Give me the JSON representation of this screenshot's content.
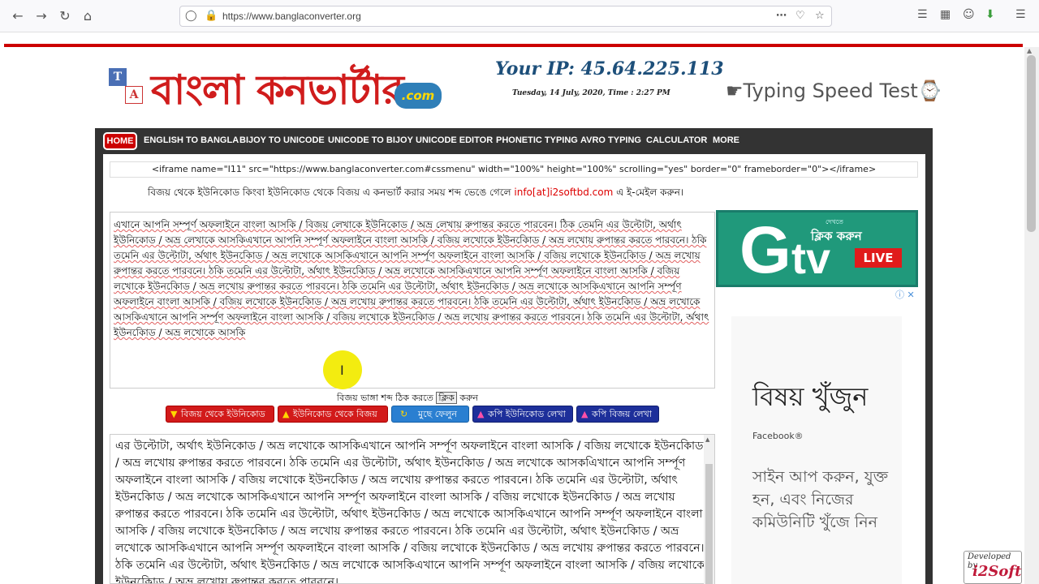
{
  "browser": {
    "url": "https://www.banglaconverter.org"
  },
  "header": {
    "brand": "বাংলা কনভার্টার",
    "brand_com": ".com",
    "ip": "Your IP: 45.64.225.113",
    "datetime": "Tuesday, 14 July, 2020, Time : 2:27 PM",
    "typing_speed": "☛Typing Speed Test⌚"
  },
  "nav": {
    "items": [
      "HOME",
      "ENGLISH TO BANGLA",
      "BIJOY TO UNICODE",
      "UNICODE TO BIJOY",
      "UNICODE EDITOR",
      "PHONETIC TYPING",
      "AVRO TYPING",
      "CALCULATOR",
      "MORE"
    ]
  },
  "embed_code": "<iframe name=\"I11\" src=\"https://www.banglaconverter.com#cssmenu\" width=\"100%\" height=\"100%\" scrolling=\"yes\" border=\"0\" frameborder=\"0\"></iframe>",
  "notice": {
    "text": "বিজয় থেকে ইউনিকোড কিংবা ইউনিকোড থেকে বিজয় এ কনভার্ট করার সময় শব্দ ভেঙে গেলে",
    "email": "info[at]i2softbd.com",
    "suffix": "এ ই-মেইল করুন।"
  },
  "input_text": "এখানে আপনি সম্পূর্ণ অফলাইনে বাংলা আসকি / বিজয় লেখাকে ইউনিকোড / অভ্র লেখায় রুপান্তর করতে পারবেন। ঠিক তেমনি এর উল্টোটা, অর্থাৎ ইউনিকোড / অভ্র লেখাকে আসকিএখানে আপনি সম্পূর্ণ অফলাইনে বাংলা আসকি / বজিয় লখোকে ইউনকিোড / অভ্র লখোয় রুপান্তর করতে পারবনে। ঠকি তমেনি এর উল্টোটা, র্অথাৎ ইউনকিোড / অভ্র লখোকে আসকিএখানে আপনি সর্ম্পূণ অফলাইনে বাংলা আসকি / বজিয় লখোকে ইউনকিোড / অভ্র লখোয় রুপান্তর করতে পারবনে। ঠকি তমেনি এর উল্টোটা, র্অথাৎ ইউনকিোড / অভ্র লখোকে আসকিএখানে আপনি সর্ম্পূণ অফলাইনে বাংলা আসকি / বজিয় লখোকে ইউনকিোড / অভ্র লখোয় রুপান্তর করতে পারবনে। ঠকি তমেনি এর উল্টোটা, র্অথাৎ ইউনকিোড / অভ্র লখোকে আসকিএখানে আপনি সর্ম্পূণ অফলাইনে বাংলা আসকি / বজিয় লখোকে ইউনকিোড / অভ্র লখোয় রুপান্তর করতে পারবনে। ঠকি তমেনি এর উল্টোটা, র্অথাৎ ইউনকিোড / অভ্র লখোকে আসকিএখানে আপনি সর্ম্পূণ অফলাইনে বাংলা আসকি / বজিয় লখোকে ইউনকিোড / অভ্র লখোয় রুপান্তর করতে পারবনে। ঠকি তমেনি এর উল্টোটা, র্অথাৎ ইউনকিোড / অভ্র লখোকে আসকি",
  "spell": {
    "before": "বিজয় ভাঙ্গা শব্দ ঠিক করতে",
    "link": "ক্লিক",
    "after": "করুন"
  },
  "buttons": {
    "b1": "বিজয় থেকে ইউনিকোড",
    "b2": "ইউনিকোড থেকে বিজয়",
    "b3": "মুছে ফেলুন",
    "b4": "কপি ইউনিকোড লেখা",
    "b5": "কপি বিজয় লেখা"
  },
  "output_text": "এর উল্টোটা, অর্থাৎ ইউনিকোড / অভ্র লখোকে আসকিএখানে আপনি সর্ম্পূণ অফলাইনে বাংলা আসকি / বজিয় লখোকে ইউনকিোড / অভ্র লখোয় রুপান্তর করতে পারবনে। ঠকি তমেনি এর উল্টোটা, র্অথাৎ ইউনকিোড / অভ্র লখোকে আসকএিখানে আপনি সর্ম্পূণ অফলাইনে বাংলা আসকি / বজিয় লখোকে ইউনকিোড / অভ্র লখোয় রুপান্তর করতে পারবনে। ঠকি তমেনি এর উল্টোটা, র্অথাৎ ইউনকিোড / অভ্র লখোকে আসকিএখানে আপনি সর্ম্পূণ অফলাইনে বাংলা আসকি / বজিয় লখোকে ইউনকিোড / অভ্র লখোয় রুপান্তর করতে পারবনে। ঠকি তমেনি এর উল্টোটা, র্অথাৎ ইউনকিোড / অভ্র লখোকে আসকিএখানে আপনি সর্ম্পূণ অফলাইনে বাংলা আসকি / বজিয় লখোকে ইউনকিোড / অভ্র লখোয় রুপান্তর করতে পারবনে। ঠকি তমেনি এর উল্টোটা, র্অথাৎ ইউনকিোড / অভ্র লখোকে আসকিএখানে আপনি সর্ম্পূণ অফলাইনে বাংলা আসকি / বজিয় লখোকে ইউনকিোড / অভ্র লখোয় রুপান্তর করতে পারবনে। ঠকি তমেনি এর উল্টোটা, র্অথাৎ ইউনকিোড / অভ্র লখোকে আসকিএখানে আপনি সর্ম্পূণ অফলাইনে বাংলা আসকি / বজিয় লখোকে ইউনকিোড / অভ্র লখোয় রুপান্তর করতে পারবনে।",
  "ad_gtv": {
    "dekhte": "দেখতে",
    "click": "ক্লিক করুন",
    "g": "G",
    "tv": "tv",
    "live": "LIVE"
  },
  "ad_side": {
    "heading": "বিষয় খুঁজুন",
    "facebook": "Facebook®",
    "body": "সাইন আপ করুন, যুক্ত হন, এবং নিজের কমিউনিটি খুঁজে নিন"
  },
  "developer": {
    "label": "Developed by",
    "logo": "i2Soft"
  }
}
